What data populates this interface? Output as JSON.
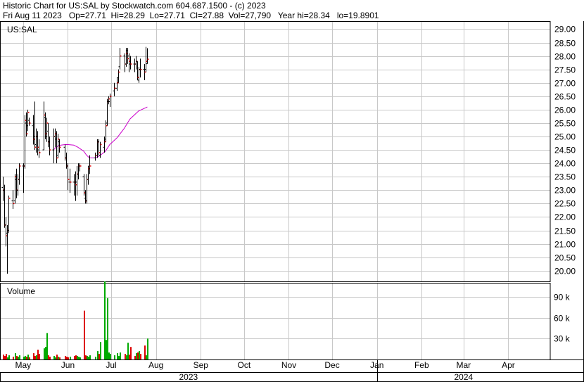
{
  "header": {
    "line1": "Historic Chart for US:SAL by Stockwatch.com 604.687.1500 - (c) 2023",
    "line2": "Fri Aug 11 2023   Op=27.71  Hi=28.29  Lo=27.71  Cl=27.88  Vol=27,790   Year hi=28.34   lo=19.8901"
  },
  "colors": {
    "up": "#00aa00",
    "down": "#dd0000",
    "ma": "#cc00cc",
    "grid": "#c8c8c8",
    "bar": "#000000"
  },
  "chart_data": [
    {
      "type": "ohlc",
      "title": "US:SAL",
      "ylim": [
        19.6,
        29.3
      ],
      "y_ticks": [
        "29.00",
        "28.50",
        "28.00",
        "27.50",
        "27.00",
        "26.50",
        "26.00",
        "25.50",
        "25.00",
        "24.50",
        "24.00",
        "23.50",
        "23.00",
        "22.50",
        "22.00",
        "21.50",
        "21.00",
        "20.50",
        "20.00"
      ],
      "x_start": "2023-04-15",
      "x_end": "2024-04-30",
      "ohlc": [
        [
          "2023-04-17",
          23.1,
          23.5,
          22.6,
          23.0
        ],
        [
          "2023-04-18",
          23.0,
          23.2,
          21.6,
          21.7
        ],
        [
          "2023-04-19",
          21.7,
          22.0,
          20.9,
          21.3
        ],
        [
          "2023-04-20",
          21.4,
          21.7,
          19.89,
          21.5
        ],
        [
          "2023-04-21",
          21.5,
          22.8,
          21.4,
          22.7
        ],
        [
          "2023-04-24",
          22.6,
          23.0,
          22.3,
          22.5
        ],
        [
          "2023-04-25",
          22.6,
          23.6,
          22.5,
          23.5
        ],
        [
          "2023-04-26",
          23.4,
          23.8,
          22.7,
          23.0
        ],
        [
          "2023-04-27",
          23.0,
          23.6,
          22.8,
          23.4
        ],
        [
          "2023-04-28",
          23.4,
          24.0,
          23.2,
          23.9
        ],
        [
          "2023-05-01",
          23.9,
          24.0,
          22.9,
          23.9
        ],
        [
          "2023-05-02",
          23.9,
          25.8,
          23.8,
          25.6
        ],
        [
          "2023-05-03",
          25.5,
          25.9,
          25.0,
          25.1
        ],
        [
          "2023-05-04",
          25.4,
          26.0,
          25.2,
          25.9
        ],
        [
          "2023-05-05",
          25.6,
          25.7,
          25.4,
          25.5
        ],
        [
          "2023-05-08",
          25.4,
          25.8,
          24.7,
          24.9
        ],
        [
          "2023-05-09",
          25.0,
          26.3,
          24.5,
          24.6
        ],
        [
          "2023-05-10",
          24.7,
          25.3,
          24.4,
          25.0
        ],
        [
          "2023-05-11",
          25.0,
          25.2,
          24.3,
          24.6
        ],
        [
          "2023-05-12",
          24.5,
          24.9,
          24.2,
          24.4
        ],
        [
          "2023-05-15",
          24.5,
          26.3,
          24.5,
          25.8
        ],
        [
          "2023-05-16",
          25.7,
          25.9,
          24.9,
          25.1
        ],
        [
          "2023-05-17",
          25.0,
          25.7,
          24.8,
          25.5
        ],
        [
          "2023-05-18",
          25.2,
          25.5,
          24.6,
          24.8
        ],
        [
          "2023-05-19",
          24.8,
          25.0,
          24.3,
          24.5
        ],
        [
          "2023-05-22",
          24.5,
          25.3,
          24.0,
          25.0
        ],
        [
          "2023-05-23",
          25.0,
          25.3,
          24.6,
          25.1
        ],
        [
          "2023-05-24",
          24.9,
          25.2,
          24.0,
          24.2
        ],
        [
          "2023-05-25",
          24.3,
          25.1,
          24.2,
          24.9
        ],
        [
          "2023-05-26",
          24.8,
          24.9,
          24.4,
          24.6
        ],
        [
          "2023-05-30",
          24.6,
          24.7,
          24.1,
          24.2
        ],
        [
          "2023-05-31",
          24.2,
          24.4,
          23.8,
          23.9
        ],
        [
          "2023-06-01",
          23.9,
          24.0,
          23.0,
          23.4
        ],
        [
          "2023-06-02",
          23.3,
          23.8,
          22.9,
          23.3
        ],
        [
          "2023-06-05",
          23.3,
          23.6,
          22.8,
          23.3
        ],
        [
          "2023-06-06",
          23.3,
          23.7,
          22.6,
          23.2
        ],
        [
          "2023-06-07",
          23.3,
          23.9,
          22.8,
          23.6
        ],
        [
          "2023-06-08",
          23.6,
          24.0,
          23.4,
          23.9
        ],
        [
          "2023-06-09",
          23.9,
          24.0,
          23.7,
          23.9
        ],
        [
          "2023-06-12",
          23.5,
          23.6,
          22.8,
          22.9
        ],
        [
          "2023-06-13",
          22.7,
          23.0,
          22.5,
          22.6
        ],
        [
          "2023-06-14",
          22.6,
          23.6,
          22.5,
          23.4
        ],
        [
          "2023-06-15",
          23.4,
          23.9,
          23.2,
          23.8
        ],
        [
          "2023-06-16",
          23.9,
          24.3,
          23.6,
          23.9
        ],
        [
          "2023-06-20",
          24.2,
          24.4,
          24.1,
          24.3
        ],
        [
          "2023-06-21",
          24.3,
          24.9,
          24.2,
          24.8
        ],
        [
          "2023-06-22",
          24.8,
          24.9,
          24.3,
          24.4
        ],
        [
          "2023-06-23",
          24.3,
          24.8,
          24.2,
          24.7
        ],
        [
          "2023-06-26",
          24.6,
          25.0,
          24.4,
          24.8
        ],
        [
          "2023-06-27",
          24.9,
          25.6,
          24.8,
          25.4
        ],
        [
          "2023-06-28",
          25.5,
          26.4,
          25.4,
          26.3
        ],
        [
          "2023-06-29",
          26.3,
          26.5,
          26.2,
          26.4
        ],
        [
          "2023-06-30",
          26.3,
          26.6,
          26.1,
          26.5
        ],
        [
          "2023-07-03",
          26.7,
          27.0,
          26.5,
          26.8
        ],
        [
          "2023-07-05",
          26.8,
          27.2,
          26.7,
          27.0
        ],
        [
          "2023-07-06",
          27.2,
          27.5,
          27.0,
          27.4
        ],
        [
          "2023-07-07",
          27.6,
          28.3,
          27.5,
          28.0
        ],
        [
          "2023-07-10",
          28.0,
          28.1,
          27.4,
          27.7
        ],
        [
          "2023-07-11",
          27.7,
          28.3,
          27.6,
          28.1
        ],
        [
          "2023-07-12",
          28.2,
          28.3,
          27.7,
          27.9
        ],
        [
          "2023-07-13",
          28.0,
          28.1,
          27.4,
          27.8
        ],
        [
          "2023-07-14",
          27.7,
          28.0,
          27.5,
          27.7
        ],
        [
          "2023-07-17",
          27.7,
          27.9,
          27.4,
          27.7
        ],
        [
          "2023-07-18",
          27.7,
          28.0,
          27.5,
          27.8
        ],
        [
          "2023-07-19",
          27.8,
          27.8,
          27.1,
          27.2
        ],
        [
          "2023-07-20",
          27.1,
          27.6,
          27.0,
          27.5
        ],
        [
          "2023-07-21",
          27.5,
          27.9,
          27.2,
          27.5
        ],
        [
          "2023-07-24",
          27.5,
          27.7,
          27.1,
          27.4
        ],
        [
          "2023-07-25",
          27.5,
          28.34,
          27.4,
          27.8
        ],
        [
          "2023-07-26",
          27.71,
          28.29,
          27.71,
          27.88
        ]
      ],
      "moving_average": [
        [
          "2023-05-22",
          24.5
        ],
        [
          "2023-05-24",
          24.6
        ],
        [
          "2023-05-26",
          24.67
        ],
        [
          "2023-05-30",
          24.7
        ],
        [
          "2023-06-01",
          24.7
        ],
        [
          "2023-06-05",
          24.68
        ],
        [
          "2023-06-08",
          24.6
        ],
        [
          "2023-06-12",
          24.45
        ],
        [
          "2023-06-14",
          24.3
        ],
        [
          "2023-06-16",
          24.2
        ],
        [
          "2023-06-20",
          24.2
        ],
        [
          "2023-06-23",
          24.28
        ],
        [
          "2023-06-27",
          24.45
        ],
        [
          "2023-06-30",
          24.7
        ],
        [
          "2023-07-05",
          24.95
        ],
        [
          "2023-07-10",
          25.3
        ],
        [
          "2023-07-14",
          25.65
        ],
        [
          "2023-07-20",
          25.95
        ],
        [
          "2023-07-26",
          26.1
        ]
      ]
    },
    {
      "type": "bar",
      "title": "Volume",
      "ylim": [
        0,
        110000
      ],
      "y_ticks": [
        "90 k",
        "60 k",
        "30 k"
      ],
      "volume": [
        [
          "2023-04-17",
          7000,
          "down"
        ],
        [
          "2023-04-18",
          5000,
          "down"
        ],
        [
          "2023-04-19",
          8000,
          "down"
        ],
        [
          "2023-04-20",
          3000,
          "up"
        ],
        [
          "2023-04-21",
          6000,
          "up"
        ],
        [
          "2023-04-24",
          4000,
          "down"
        ],
        [
          "2023-04-25",
          9000,
          "up"
        ],
        [
          "2023-04-26",
          5000,
          "down"
        ],
        [
          "2023-04-27",
          4000,
          "up"
        ],
        [
          "2023-04-28",
          6000,
          "up"
        ],
        [
          "2023-05-01",
          4000,
          "up"
        ],
        [
          "2023-05-02",
          5000,
          "up"
        ],
        [
          "2023-05-03",
          4000,
          "down"
        ],
        [
          "2023-05-04",
          7000,
          "up"
        ],
        [
          "2023-05-05",
          3000,
          "down"
        ],
        [
          "2023-05-08",
          9000,
          "down"
        ],
        [
          "2023-05-09",
          5000,
          "down"
        ],
        [
          "2023-05-10",
          6000,
          "up"
        ],
        [
          "2023-05-11",
          14000,
          "down"
        ],
        [
          "2023-05-12",
          8000,
          "down"
        ],
        [
          "2023-05-15",
          16000,
          "up"
        ],
        [
          "2023-05-16",
          18000,
          "up"
        ],
        [
          "2023-05-17",
          38000,
          "up"
        ],
        [
          "2023-05-18",
          6000,
          "down"
        ],
        [
          "2023-05-19",
          4000,
          "down"
        ],
        [
          "2023-05-22",
          5000,
          "up"
        ],
        [
          "2023-05-23",
          3000,
          "up"
        ],
        [
          "2023-05-24",
          7000,
          "down"
        ],
        [
          "2023-05-25",
          4000,
          "up"
        ],
        [
          "2023-05-26",
          3000,
          "down"
        ],
        [
          "2023-05-30",
          5000,
          "down"
        ],
        [
          "2023-05-31",
          4000,
          "down"
        ],
        [
          "2023-06-01",
          3000,
          "down"
        ],
        [
          "2023-06-02",
          4000,
          "up"
        ],
        [
          "2023-06-05",
          5000,
          "down"
        ],
        [
          "2023-06-06",
          6000,
          "down"
        ],
        [
          "2023-06-07",
          5000,
          "up"
        ],
        [
          "2023-06-08",
          4000,
          "up"
        ],
        [
          "2023-06-09",
          3000,
          "up"
        ],
        [
          "2023-06-12",
          70000,
          "down"
        ],
        [
          "2023-06-13",
          6000,
          "down"
        ],
        [
          "2023-06-14",
          5000,
          "up"
        ],
        [
          "2023-06-15",
          4000,
          "up"
        ],
        [
          "2023-06-16",
          6000,
          "up"
        ],
        [
          "2023-06-20",
          4000,
          "up"
        ],
        [
          "2023-06-21",
          12000,
          "up"
        ],
        [
          "2023-06-22",
          8000,
          "down"
        ],
        [
          "2023-06-23",
          25000,
          "up"
        ],
        [
          "2023-06-26",
          112000,
          "up"
        ],
        [
          "2023-06-27",
          28000,
          "up"
        ],
        [
          "2023-06-28",
          88000,
          "up"
        ],
        [
          "2023-06-29",
          10000,
          "up"
        ],
        [
          "2023-06-30",
          8000,
          "up"
        ],
        [
          "2023-07-03",
          6000,
          "up"
        ],
        [
          "2023-07-05",
          9000,
          "up"
        ],
        [
          "2023-07-06",
          5000,
          "up"
        ],
        [
          "2023-07-07",
          10000,
          "up"
        ],
        [
          "2023-07-10",
          8000,
          "down"
        ],
        [
          "2023-07-11",
          6000,
          "up"
        ],
        [
          "2023-07-12",
          24000,
          "up"
        ],
        [
          "2023-07-13",
          7000,
          "down"
        ],
        [
          "2023-07-14",
          18000,
          "down"
        ],
        [
          "2023-07-17",
          5000,
          "down"
        ],
        [
          "2023-07-18",
          9000,
          "up"
        ],
        [
          "2023-07-19",
          10000,
          "down"
        ],
        [
          "2023-07-20",
          12000,
          "up"
        ],
        [
          "2023-07-21",
          8000,
          "down"
        ],
        [
          "2023-07-24",
          20000,
          "down"
        ],
        [
          "2023-07-25",
          6000,
          "up"
        ],
        [
          "2023-07-26",
          30000,
          "up"
        ]
      ]
    }
  ],
  "x_axis": {
    "months": [
      [
        "2023-05-01",
        "May"
      ],
      [
        "2023-06-01",
        "Jun"
      ],
      [
        "2023-07-01",
        "Jul"
      ],
      [
        "2023-08-01",
        "Aug"
      ],
      [
        "2023-09-01",
        "Sep"
      ],
      [
        "2023-10-01",
        "Oct"
      ],
      [
        "2023-11-01",
        "Nov"
      ],
      [
        "2023-12-01",
        "Dec"
      ],
      [
        "2024-01-01",
        "Jan"
      ],
      [
        "2024-02-01",
        "Feb"
      ],
      [
        "2024-03-01",
        "Mar"
      ],
      [
        "2024-04-01",
        "Apr"
      ]
    ],
    "years": [
      [
        "2023-04-15",
        "2024-01-01",
        "2023"
      ],
      [
        "2024-01-01",
        "2024-04-30",
        "2024"
      ]
    ]
  }
}
